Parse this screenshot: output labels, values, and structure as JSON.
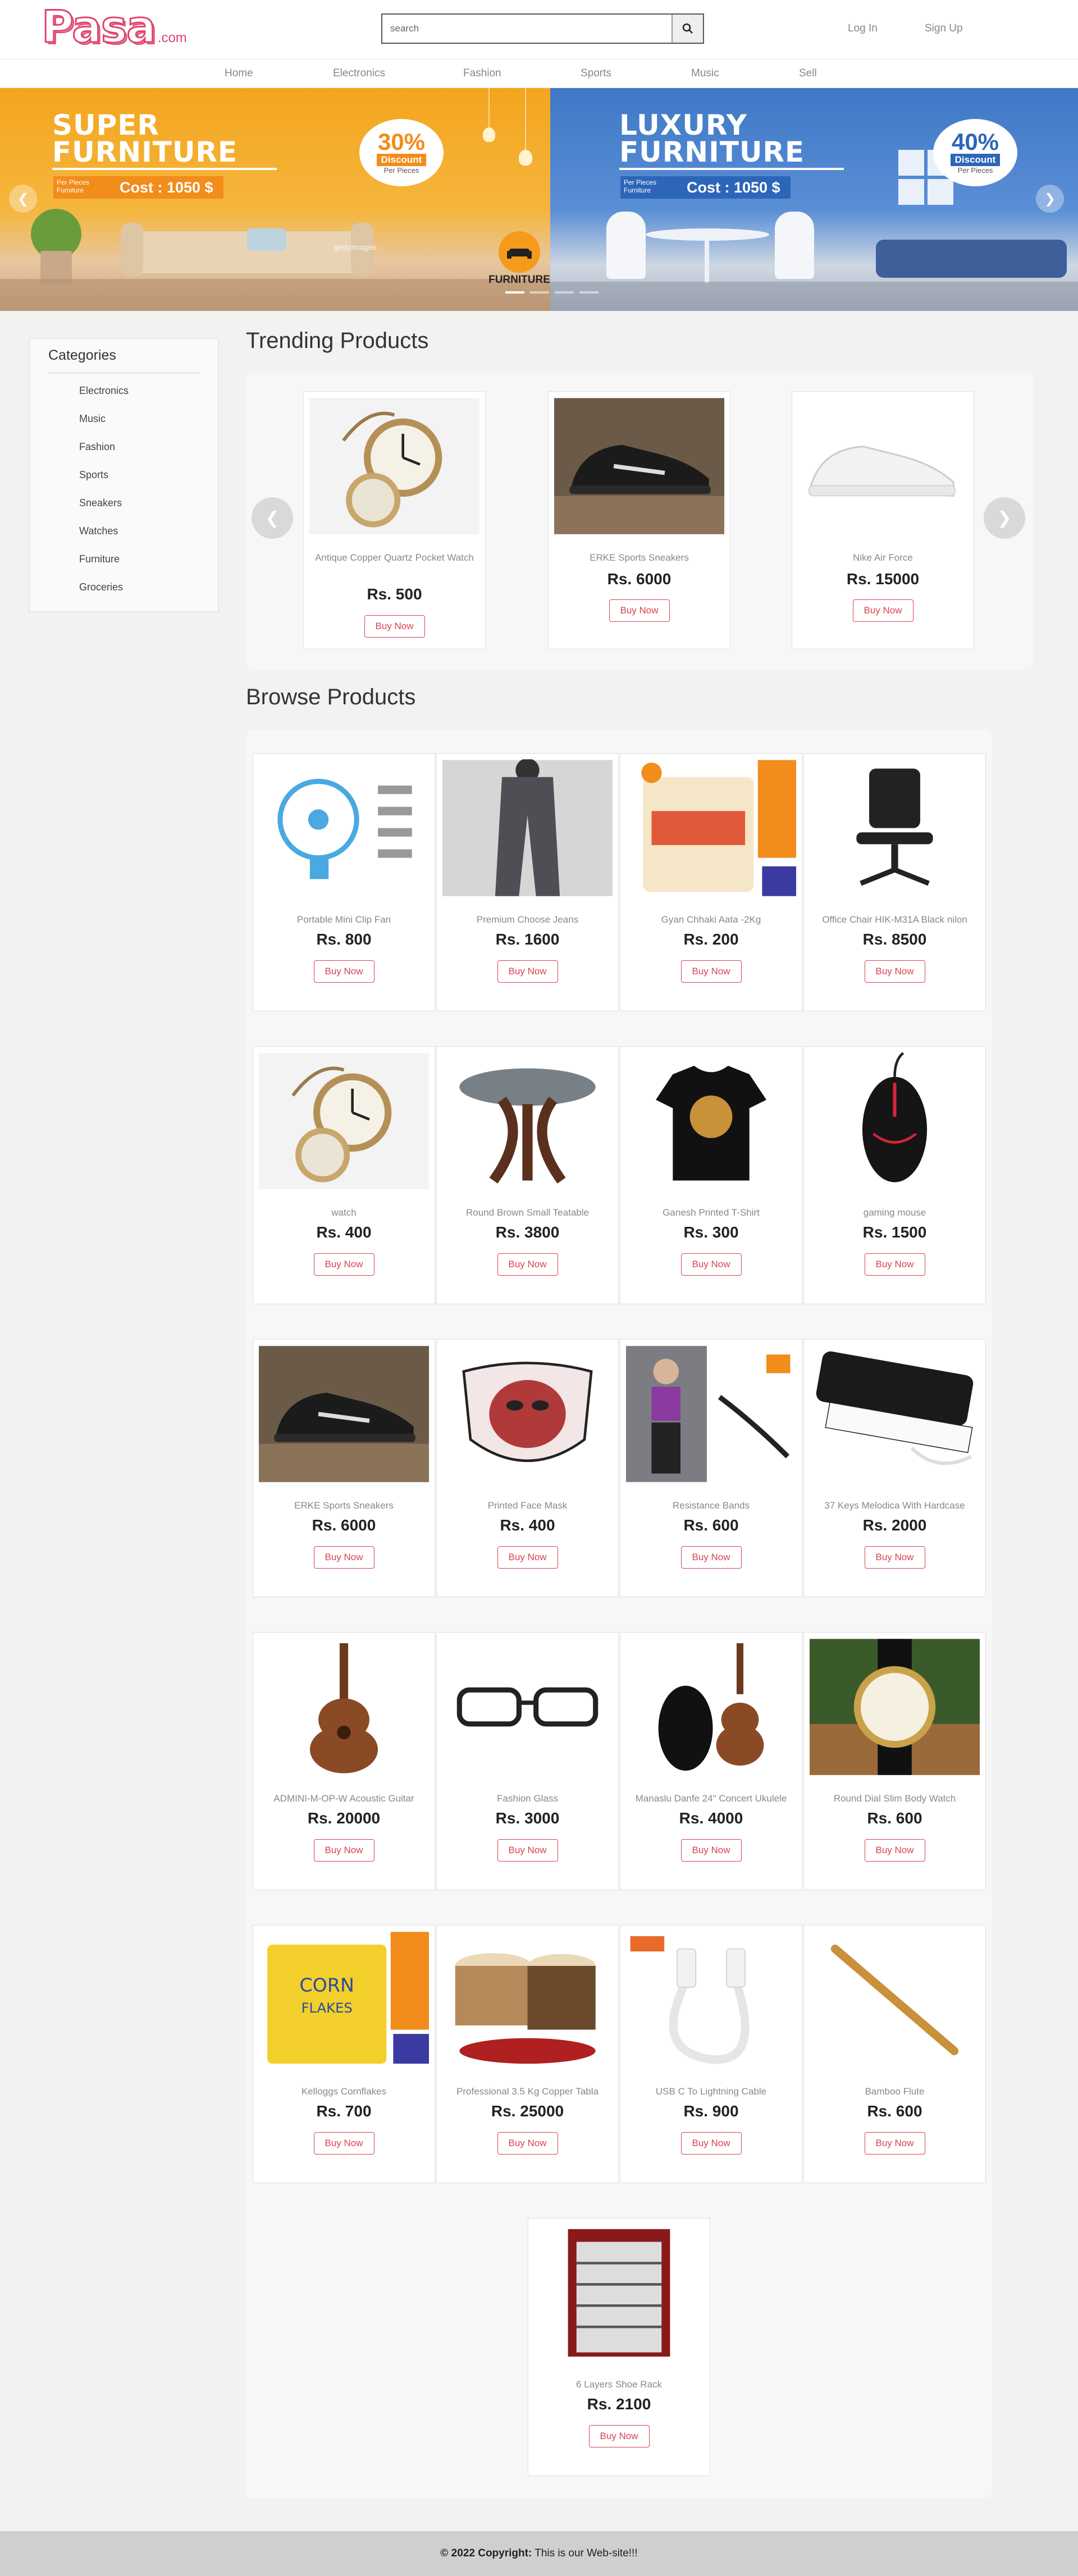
{
  "header": {
    "logo_main": "Pasa",
    "logo_suffix": ".com",
    "search_placeholder": "search",
    "login_label": "Log In",
    "signup_label": "Sign Up",
    "nav": [
      "Home",
      "Electronics",
      "Fashion",
      "Sports",
      "Music",
      "Sell"
    ]
  },
  "hero": {
    "left": {
      "title_line1": "SUPER",
      "title_line2": "FURNITURE",
      "per_pieces": "Per Pieces Furniture",
      "cost": "Cost : 1050 $",
      "discount_pct": "30%",
      "discount_word": "Discount",
      "discount_sub": "Per Pieces",
      "watermark": "gettyimages",
      "brand": "FURNITURE",
      "accent": "#f28c1a"
    },
    "right": {
      "title_line1": "LUXURY",
      "title_line2": "FURNITURE",
      "per_pieces": "Per Pieces Furniture",
      "cost": "Cost : 1050 $",
      "discount_pct": "40%",
      "discount_word": "Discount",
      "discount_sub": "Per Pieces",
      "accent": "#2d66b8"
    }
  },
  "sidebar": {
    "title": "Categories",
    "items": [
      "Electronics",
      "Music",
      "Fashion",
      "Sports",
      "Sneakers",
      "Watches",
      "Furniture",
      "Groceries"
    ]
  },
  "trending": {
    "title": "Trending Products",
    "products": [
      {
        "name": "Antique Copper Quartz Pocket Watch",
        "price": "Rs. 500",
        "button": "Buy Now",
        "icon": "pocket-watch-icon"
      },
      {
        "name": "ERKE Sports Sneakers",
        "price": "Rs. 6000",
        "button": "Buy Now",
        "icon": "sneaker-icon"
      },
      {
        "name": "Nike Air Force",
        "price": "Rs. 15000",
        "button": "Buy Now",
        "icon": "sneaker-white-icon"
      }
    ]
  },
  "browse": {
    "title": "Browse Products",
    "products": [
      {
        "name": "Portable Mini Clip Fan",
        "price": "Rs. 800",
        "button": "Buy Now",
        "icon": "fan-icon"
      },
      {
        "name": "Premium Choose Jeans",
        "price": "Rs. 1600",
        "button": "Buy Now",
        "icon": "jeans-icon"
      },
      {
        "name": "Gyan Chhaki Aata -2Kg",
        "price": "Rs. 200",
        "button": "Buy Now",
        "icon": "flour-bag-icon"
      },
      {
        "name": "Office Chair HIK-M31A Black nilon",
        "price": "Rs. 8500",
        "button": "Buy Now",
        "icon": "office-chair-icon"
      },
      {
        "name": "watch",
        "price": "Rs. 400",
        "button": "Buy Now",
        "icon": "pocket-watch-icon"
      },
      {
        "name": "Round Brown Small Teatable",
        "price": "Rs. 3800",
        "button": "Buy Now",
        "icon": "table-icon"
      },
      {
        "name": "Ganesh Printed T-Shirt",
        "price": "Rs. 300",
        "button": "Buy Now",
        "icon": "tshirt-icon"
      },
      {
        "name": "gaming mouse",
        "price": "Rs. 1500",
        "button": "Buy Now",
        "icon": "mouse-icon"
      },
      {
        "name": "ERKE Sports Sneakers",
        "price": "Rs. 6000",
        "button": "Buy Now",
        "icon": "sneaker-icon"
      },
      {
        "name": "Printed Face Mask",
        "price": "Rs. 400",
        "button": "Buy Now",
        "icon": "face-mask-icon"
      },
      {
        "name": "Resistance Bands",
        "price": "Rs. 600",
        "button": "Buy Now",
        "icon": "resistance-band-icon"
      },
      {
        "name": "37 Keys Melodica With Hardcase",
        "price": "Rs. 2000",
        "button": "Buy Now",
        "icon": "melodica-icon"
      },
      {
        "name": "ADMINI-M-OP-W Acoustic Guitar",
        "price": "Rs. 20000",
        "button": "Buy Now",
        "icon": "guitar-icon"
      },
      {
        "name": "Fashion Glass",
        "price": "Rs. 3000",
        "button": "Buy Now",
        "icon": "glasses-icon"
      },
      {
        "name": "Manaslu Danfe 24\" Concert Ukulele",
        "price": "Rs. 4000",
        "button": "Buy Now",
        "icon": "ukulele-icon"
      },
      {
        "name": "Round Dial Slim Body Watch",
        "price": "Rs. 600",
        "button": "Buy Now",
        "icon": "wrist-watch-icon"
      },
      {
        "name": "Kelloggs Cornflakes",
        "price": "Rs. 700",
        "button": "Buy Now",
        "icon": "cereal-box-icon"
      },
      {
        "name": "Professional 3.5 Kg Copper Tabla",
        "price": "Rs. 25000",
        "button": "Buy Now",
        "icon": "tabla-icon"
      },
      {
        "name": "USB C To Lightning Cable",
        "price": "Rs. 900",
        "button": "Buy Now",
        "icon": "cable-icon"
      },
      {
        "name": "Bamboo Flute",
        "price": "Rs. 600",
        "button": "Buy Now",
        "icon": "flute-icon"
      },
      {
        "name": "6 Layers Shoe Rack",
        "price": "Rs. 2100",
        "button": "Buy Now",
        "icon": "shoe-rack-icon"
      }
    ]
  },
  "footer": {
    "copyright_label": "© 2022 Copyright:",
    "text": "This is our Web-site!!!"
  }
}
